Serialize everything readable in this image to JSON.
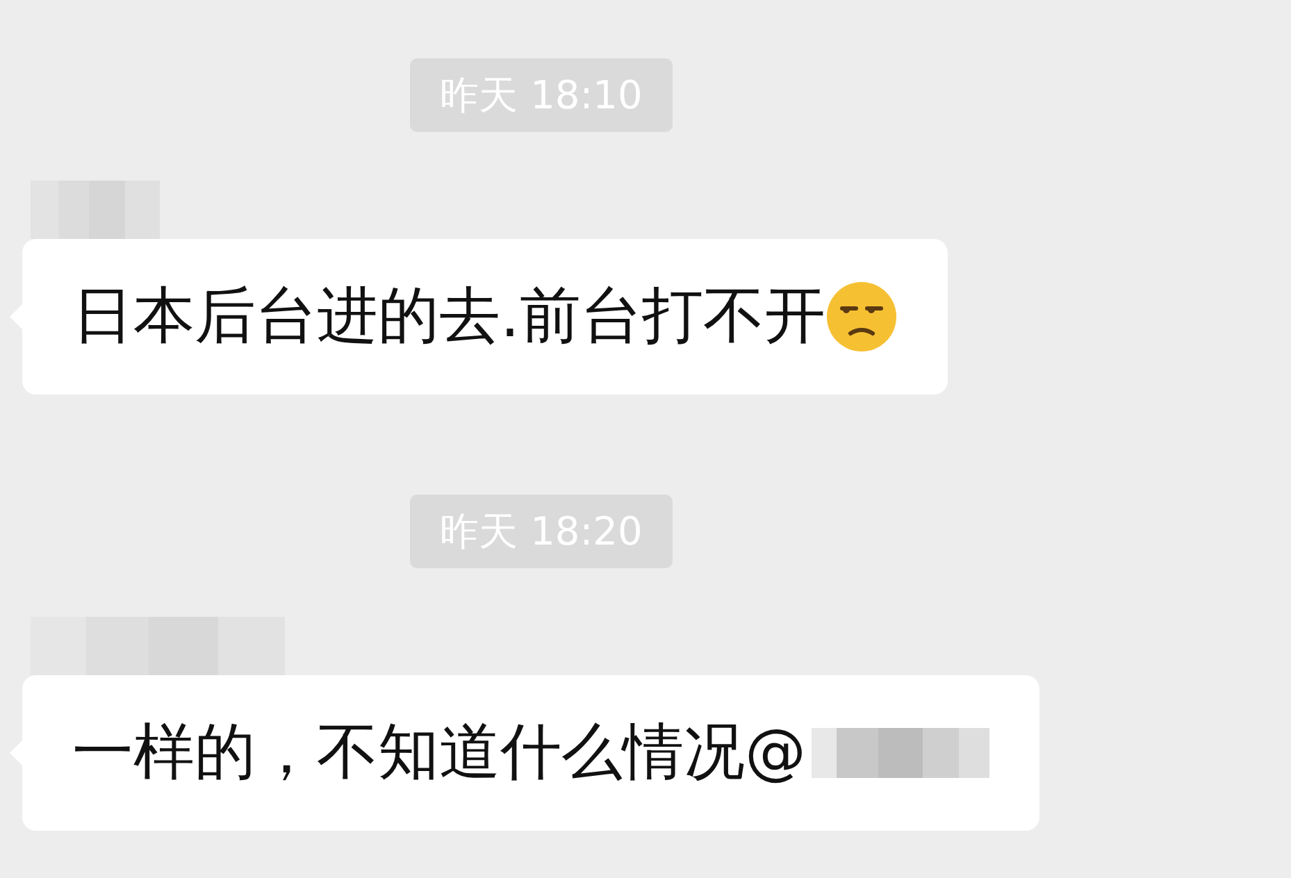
{
  "messages": [
    {
      "kind": "time",
      "text": "昨天 18:10"
    },
    {
      "kind": "incoming",
      "text": "日本后台进的去.前台打不开",
      "emoji": true
    },
    {
      "kind": "time",
      "text": "昨天 18:20"
    },
    {
      "kind": "incoming",
      "text": "一样的，不知道什么情况@",
      "mention": true
    }
  ]
}
